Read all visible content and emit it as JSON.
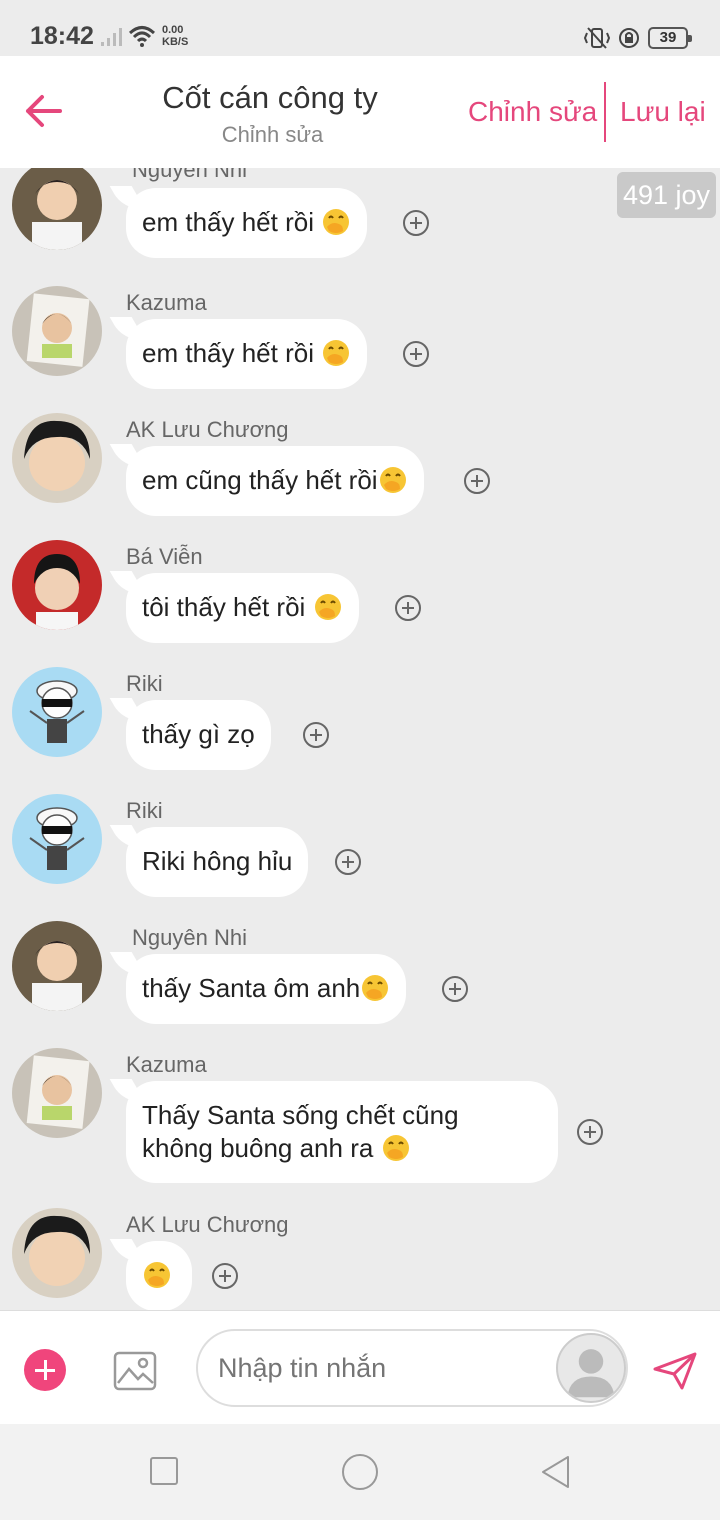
{
  "status": {
    "time": "18:42",
    "speed_top": "0.00",
    "speed_bottom": "KB/S",
    "battery": "39"
  },
  "header": {
    "title": "Cốt cán công ty",
    "subtitle": "Chỉnh sửa",
    "edit_label": "Chỉnh sửa",
    "save_label": "Lưu lại"
  },
  "joy_badge": "491 joy",
  "messages": [
    {
      "sender": "Nguyên Nhi",
      "text": "em thấy hết rồi "
    },
    {
      "sender": "Kazuma",
      "text": "em thấy hết rồi "
    },
    {
      "sender": "AK Lưu Chương",
      "text": "em cũng thấy hết rồi"
    },
    {
      "sender": "Bá Viễn",
      "text": "tôi thấy hết rồi "
    },
    {
      "sender": "Riki",
      "text": "thấy gì zọ"
    },
    {
      "sender": "Riki",
      "text": "Riki hông hỉu"
    },
    {
      "sender": "Nguyên Nhi",
      "text": "thấy Santa ôm anh"
    },
    {
      "sender": "Kazuma",
      "text_line1": "Thấy Santa sống chết cũng",
      "text_line2": "không buông anh ra "
    },
    {
      "sender": "AK Lưu Chương",
      "text": ""
    }
  ],
  "input": {
    "placeholder": "Nhập tin nhắn"
  },
  "colors": {
    "accent": "#e5477c",
    "background": "#ececec",
    "bubble": "#ffffff"
  },
  "icons": {
    "back": "arrow-left-icon",
    "send": "paper-plane-icon",
    "attach": "plus-icon",
    "image": "image-icon",
    "emoji": "face-with-hand-over-mouth"
  }
}
